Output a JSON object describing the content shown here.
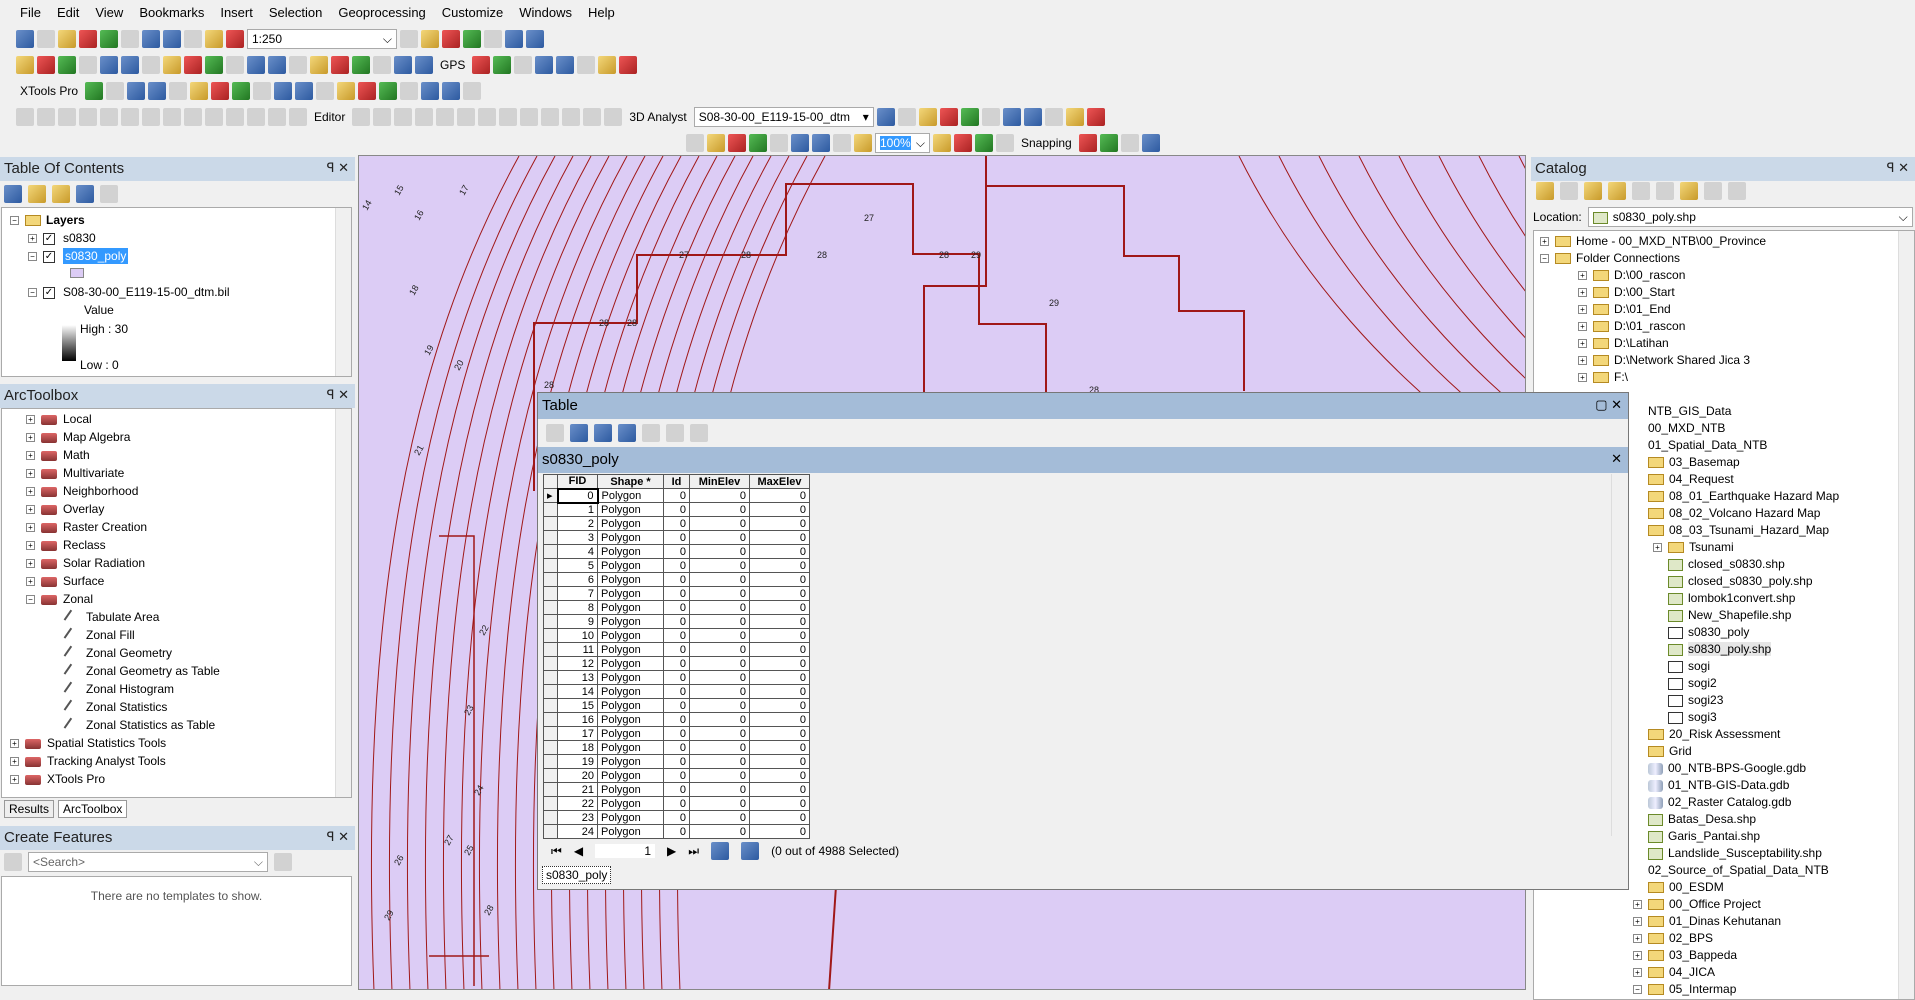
{
  "menu": [
    "File",
    "Edit",
    "View",
    "Bookmarks",
    "Insert",
    "Selection",
    "Geoprocessing",
    "Customize",
    "Windows",
    "Help"
  ],
  "toolbar": {
    "scale": "1:250",
    "gps": "GPS",
    "xtools": "XTools Pro",
    "editor": "Editor",
    "analyst": "3D Analyst",
    "layer_select": "S08-30-00_E119-15-00_dtm",
    "zoom_pct": "100%",
    "snapping": "Snapping",
    "row1": [
      "new-icon",
      "open-icon",
      "save-icon",
      "print-icon",
      "cut-icon",
      "copy-icon",
      "paste-icon",
      "delete-icon",
      "undo-icon",
      "redo-icon",
      "add-data-icon"
    ],
    "row1b": [
      "editor-toolbar-icon",
      "toc-icon",
      "catalog-icon",
      "search-window-icon",
      "arctoolbox-icon",
      "python-icon",
      "modelbuilder-icon"
    ],
    "row2": [
      "zoom-in-icon",
      "zoom-out-icon",
      "pan-icon",
      "full-extent-icon",
      "fixed-zoom-in-icon",
      "fixed-zoom-out-icon",
      "back-icon",
      "forward-icon",
      "select-features-icon",
      "clear-selection-icon",
      "select-elements-icon",
      "identify-icon",
      "hyperlink-icon",
      "html-popup-icon",
      "measure-icon",
      "find-icon",
      "find-route-icon",
      "goto-xy-icon",
      "time-slider-icon",
      "magnifier-icon"
    ],
    "row2b": [
      "gps-icon-1",
      "gps-icon-2",
      "gps-icon-3",
      "gps-icon-4",
      "gps-icon-5",
      "gps-icon-6",
      "gps-icon-7",
      "flag-icon"
    ],
    "row3": [
      "xtools-add-icon",
      "table-icon",
      "pencil-icon",
      "xtools-icon-1",
      "xtools-icon-2",
      "xtools-icon-3",
      "xtools-icon-4",
      "info-icon",
      "xtools-info-icon",
      "xtools-icon-5",
      "xtools-icon-6",
      "xtools-icon-7",
      "xtools-icon-8",
      "xtools-icon-9",
      "xtools-icon-10",
      "xtools-icon-11",
      "xtools-icon-12",
      "xtools-icon-13",
      "xtools-icon-14"
    ],
    "row4": [
      "topo-icon-1",
      "topo-icon-2",
      "topo-icon-3",
      "topo-icon-4",
      "topo-icon-5",
      "topo-icon-6",
      "topo-icon-7",
      "topo-icon-8",
      "topo-icon-9",
      "topo-icon-10",
      "topo-icon-11",
      "topo-icon-12",
      "topo-icon-13",
      "topo-icon-14"
    ],
    "row4b": [
      "edit-tool-icon",
      "edit-annotation-icon",
      "straight-segment-icon",
      "trace-icon",
      "point-icon",
      "vertex-icon",
      "split-icon",
      "reshape-icon",
      "cut-polygon-icon",
      "rotate-icon",
      "attributes-icon",
      "sketch-properties-icon",
      "create-features-icon"
    ],
    "row4c": [
      "analyst-icon-1",
      "analyst-icon-2",
      "analyst-icon-3",
      "analyst-icon-4",
      "analyst-icon-5",
      "analyst-icon-6",
      "profile-icon",
      "globe-icon",
      "arcscene-icon",
      "add-data-web-icon",
      "help-icon"
    ],
    "row5": [
      "layout-zoom-in-icon",
      "layout-zoom-out-icon",
      "layout-pan-icon",
      "zoom-whole-page-icon",
      "zoom-100-icon",
      "layout-fixed-in-icon",
      "layout-fixed-out-icon",
      "layout-back-icon",
      "layout-forward-icon"
    ],
    "row5b": [
      "toggle-draft-icon",
      "focus-frame-icon",
      "change-layout-icon",
      "data-driven-pages-icon"
    ],
    "row5c": [
      "snap-point-icon",
      "snap-end-icon",
      "snap-vertex-icon",
      "snap-edge-icon"
    ]
  },
  "toc": {
    "title": "Table Of Contents",
    "group": "Layers",
    "layers": [
      "s0830",
      "s0830_poly",
      "S08-30-00_E119-15-00_dtm.bil"
    ],
    "legend_title": "Value",
    "high": "High : 30",
    "low": "Low : 0",
    "poly_color": "#dcccf5"
  },
  "toolbox": {
    "title": "ArcToolbox",
    "items": [
      "Local",
      "Map Algebra",
      "Math",
      "Multivariate",
      "Neighborhood",
      "Overlay",
      "Raster Creation",
      "Reclass",
      "Solar Radiation",
      "Surface",
      "Zonal"
    ],
    "zonal_tools": [
      "Tabulate Area",
      "Zonal Fill",
      "Zonal Geometry",
      "Zonal Geometry as Table",
      "Zonal Histogram",
      "Zonal Statistics",
      "Zonal Statistics as Table"
    ],
    "top_items": [
      "Spatial Statistics Tools",
      "Tracking Analyst Tools",
      "XTools Pro"
    ],
    "tabs": [
      "Results",
      "ArcToolbox"
    ]
  },
  "create": {
    "title": "Create Features",
    "search_placeholder": "<Search>",
    "empty": "There are no templates to show."
  },
  "catalog": {
    "title": "Catalog",
    "location_label": "Location:",
    "location": "s0830_poly.shp",
    "items": [
      {
        "l": 0,
        "t": "home",
        "pm": "+",
        "n": "Home - 00_MXD_NTB\\00_Province"
      },
      {
        "l": 0,
        "t": "home",
        "pm": "-",
        "n": "Folder Connections"
      },
      {
        "l": 1,
        "t": "fold",
        "pm": "+",
        "n": "D:\\00_rascon"
      },
      {
        "l": 1,
        "t": "fold",
        "pm": "+",
        "n": "D:\\00_Start"
      },
      {
        "l": 1,
        "t": "fold",
        "pm": "+",
        "n": "D:\\01_End"
      },
      {
        "l": 1,
        "t": "fold",
        "pm": "+",
        "n": "D:\\01_rascon"
      },
      {
        "l": 1,
        "t": "fold",
        "pm": "+",
        "n": "D:\\Latihan"
      },
      {
        "l": 1,
        "t": "fold",
        "pm": "+",
        "n": "D:\\Network Shared Jica 3"
      },
      {
        "l": 1,
        "t": "fold",
        "pm": "+",
        "n": "F:\\"
      },
      {
        "l": 2,
        "t": "",
        "pm": "",
        "n": ""
      },
      {
        "l": 2,
        "t": "",
        "pm": "",
        "n": "NTB_GIS_Data"
      },
      {
        "l": 2,
        "t": "",
        "pm": "",
        "n": "00_MXD_NTB"
      },
      {
        "l": 2,
        "t": "",
        "pm": "",
        "n": "01_Spatial_Data_NTB"
      },
      {
        "l": 3,
        "t": "fold",
        "pm": "",
        "n": "03_Basemap"
      },
      {
        "l": 3,
        "t": "fold",
        "pm": "",
        "n": "04_Request"
      },
      {
        "l": 3,
        "t": "fold",
        "pm": "",
        "n": "08_01_Earthquake Hazard Map"
      },
      {
        "l": 3,
        "t": "fold",
        "pm": "",
        "n": "08_02_Volcano Hazard Map"
      },
      {
        "l": 3,
        "t": "fold",
        "pm": "",
        "n": "08_03_Tsunami_Hazard_Map"
      },
      {
        "l": 4,
        "t": "fold",
        "pm": "+",
        "n": "Tsunami"
      },
      {
        "l": 4,
        "t": "shp",
        "pm": "",
        "n": "closed_s0830.shp"
      },
      {
        "l": 4,
        "t": "shp",
        "pm": "",
        "n": "closed_s0830_poly.shp"
      },
      {
        "l": 4,
        "t": "shp",
        "pm": "",
        "n": "lombok1convert.shp"
      },
      {
        "l": 4,
        "t": "shp",
        "pm": "",
        "n": "New_Shapefile.shp"
      },
      {
        "l": 4,
        "t": "tbl",
        "pm": "",
        "n": "s0830_poly"
      },
      {
        "l": 4,
        "t": "shp",
        "pm": "",
        "n": "s0830_poly.shp"
      },
      {
        "l": 4,
        "t": "tbl",
        "pm": "",
        "n": "sogi"
      },
      {
        "l": 4,
        "t": "tbl",
        "pm": "",
        "n": "sogi2"
      },
      {
        "l": 4,
        "t": "tbl",
        "pm": "",
        "n": "sogi23"
      },
      {
        "l": 4,
        "t": "tbl",
        "pm": "",
        "n": "sogi3"
      },
      {
        "l": 3,
        "t": "fold",
        "pm": "",
        "n": "20_Risk Assessment"
      },
      {
        "l": 3,
        "t": "fold",
        "pm": "",
        "n": "Grid"
      },
      {
        "l": 3,
        "t": "gdb",
        "pm": "",
        "n": "00_NTB-BPS-Google.gdb"
      },
      {
        "l": 3,
        "t": "gdb",
        "pm": "",
        "n": "01_NTB-GIS-Data.gdb"
      },
      {
        "l": 3,
        "t": "gdb",
        "pm": "",
        "n": "02_Raster Catalog.gdb"
      },
      {
        "l": 3,
        "t": "shp",
        "pm": "",
        "n": "Batas_Desa.shp"
      },
      {
        "l": 3,
        "t": "shp",
        "pm": "",
        "n": "Garis_Pantai.shp"
      },
      {
        "l": 3,
        "t": "shp",
        "pm": "",
        "n": "Landslide_Susceptability.shp"
      },
      {
        "l": 2,
        "t": "",
        "pm": "",
        "n": "02_Source_of_Spatial_Data_NTB"
      },
      {
        "l": 3,
        "t": "fold",
        "pm": "",
        "n": "00_ESDM"
      },
      {
        "l": 3,
        "t": "fold",
        "pm": "+",
        "n": "00_Office Project"
      },
      {
        "l": 3,
        "t": "fold",
        "pm": "+",
        "n": "01_Dinas Kehutanan"
      },
      {
        "l": 3,
        "t": "fold",
        "pm": "+",
        "n": "02_BPS"
      },
      {
        "l": 3,
        "t": "fold",
        "pm": "+",
        "n": "03_Bappeda"
      },
      {
        "l": 3,
        "t": "fold",
        "pm": "+",
        "n": "04_JICA"
      },
      {
        "l": 3,
        "t": "fold",
        "pm": "-",
        "n": "05_Intermap"
      }
    ]
  },
  "map": {
    "background": "#dcccf5",
    "line_color": "#a01818",
    "labels": [
      "14",
      "15",
      "16",
      "17",
      "18",
      "19",
      "20",
      "21",
      "22",
      "23",
      "24",
      "25",
      "26",
      "27",
      "28",
      "29"
    ],
    "poly_labels": [
      "27",
      "28",
      "28",
      "28",
      "28",
      "27",
      "28",
      "29",
      "29",
      "28",
      "28"
    ]
  },
  "table": {
    "window_title": "Table",
    "layer_title": "s0830_poly",
    "columns": [
      "FID",
      "Shape *",
      "Id",
      "MinElev",
      "MaxElev"
    ],
    "rows": [
      [
        0,
        "Polygon",
        0,
        0,
        0
      ],
      [
        1,
        "Polygon",
        0,
        0,
        0
      ],
      [
        2,
        "Polygon",
        0,
        0,
        0
      ],
      [
        3,
        "Polygon",
        0,
        0,
        0
      ],
      [
        4,
        "Polygon",
        0,
        0,
        0
      ],
      [
        5,
        "Polygon",
        0,
        0,
        0
      ],
      [
        6,
        "Polygon",
        0,
        0,
        0
      ],
      [
        7,
        "Polygon",
        0,
        0,
        0
      ],
      [
        8,
        "Polygon",
        0,
        0,
        0
      ],
      [
        9,
        "Polygon",
        0,
        0,
        0
      ],
      [
        10,
        "Polygon",
        0,
        0,
        0
      ],
      [
        11,
        "Polygon",
        0,
        0,
        0
      ],
      [
        12,
        "Polygon",
        0,
        0,
        0
      ],
      [
        13,
        "Polygon",
        0,
        0,
        0
      ],
      [
        14,
        "Polygon",
        0,
        0,
        0
      ],
      [
        15,
        "Polygon",
        0,
        0,
        0
      ],
      [
        16,
        "Polygon",
        0,
        0,
        0
      ],
      [
        17,
        "Polygon",
        0,
        0,
        0
      ],
      [
        18,
        "Polygon",
        0,
        0,
        0
      ],
      [
        19,
        "Polygon",
        0,
        0,
        0
      ],
      [
        20,
        "Polygon",
        0,
        0,
        0
      ],
      [
        21,
        "Polygon",
        0,
        0,
        0
      ],
      [
        22,
        "Polygon",
        0,
        0,
        0
      ],
      [
        23,
        "Polygon",
        0,
        0,
        0
      ],
      [
        24,
        "Polygon",
        0,
        0,
        0
      ]
    ],
    "record": "1",
    "selected": "(0 out of 4988 Selected)",
    "tab": "s0830_poly"
  }
}
